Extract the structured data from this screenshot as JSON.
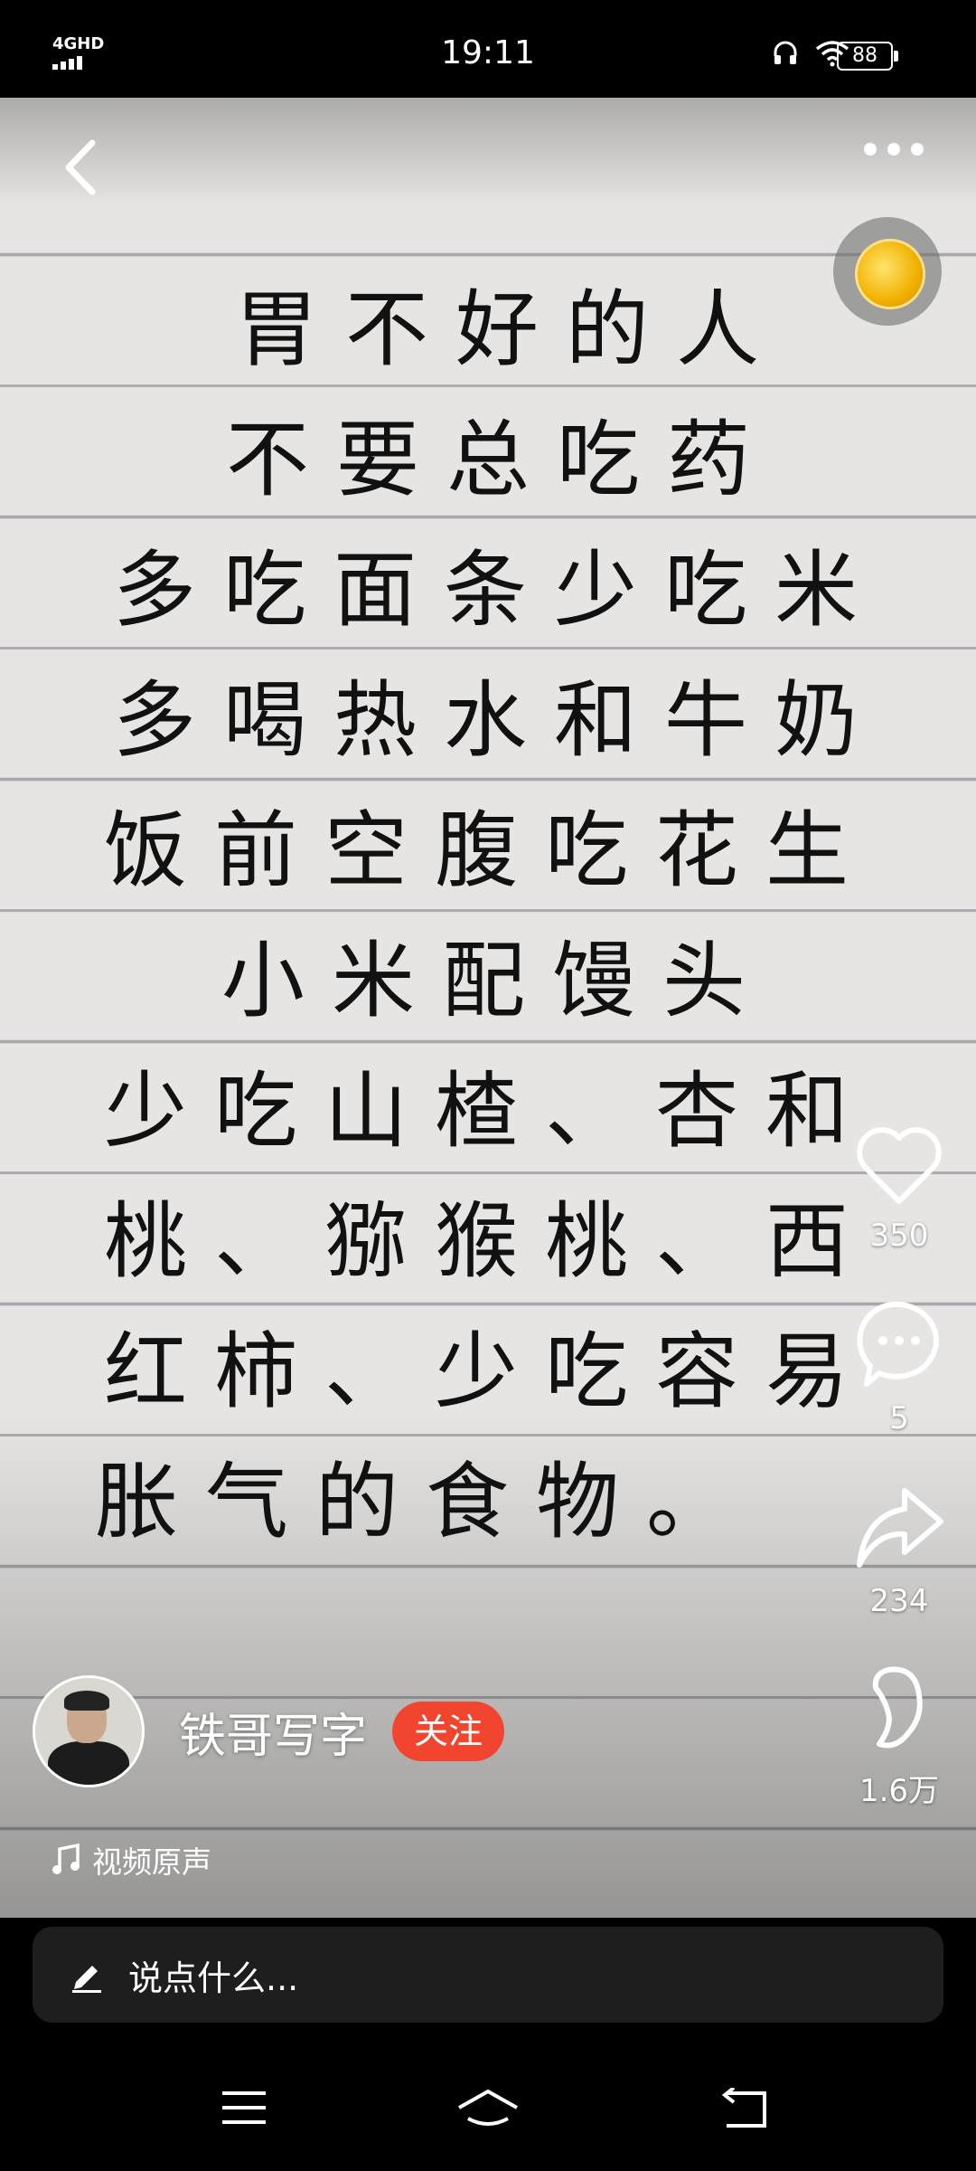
{
  "status_bar": {
    "network": "4GHD",
    "time": "19:11",
    "battery": "88"
  },
  "video": {
    "poem_lines": [
      "胃不好的人",
      "不要总吃药",
      "多吃面条少吃米",
      "多喝热水和牛奶",
      "饭前空腹吃花生",
      "小米配馒头",
      "少吃山楂、杏和",
      "桃、猕猴桃、西",
      "红柿、少吃容易",
      "胀气的食物。"
    ]
  },
  "actions": {
    "likes": "350",
    "comments": "5",
    "shares": "234",
    "favorites": "1.6万"
  },
  "author": {
    "name": "铁哥写字",
    "follow_label": "关注"
  },
  "sound": {
    "label": "视频原声"
  },
  "comment_bar": {
    "placeholder": "说点什么..."
  },
  "colors": {
    "follow": "#f2452f",
    "background": "#000000",
    "paper": "#e6e5e3"
  }
}
